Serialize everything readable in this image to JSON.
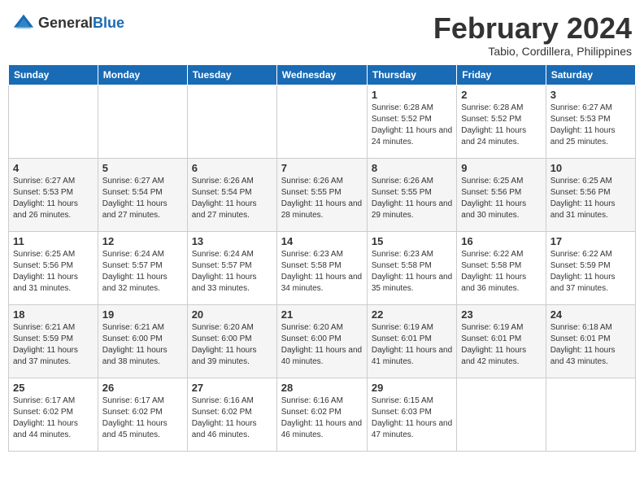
{
  "header": {
    "logo_general": "General",
    "logo_blue": "Blue",
    "month": "February 2024",
    "location": "Tabio, Cordillera, Philippines"
  },
  "days_of_week": [
    "Sunday",
    "Monday",
    "Tuesday",
    "Wednesday",
    "Thursday",
    "Friday",
    "Saturday"
  ],
  "weeks": [
    [
      {
        "day": "",
        "sunrise": "",
        "sunset": "",
        "daylight": ""
      },
      {
        "day": "",
        "sunrise": "",
        "sunset": "",
        "daylight": ""
      },
      {
        "day": "",
        "sunrise": "",
        "sunset": "",
        "daylight": ""
      },
      {
        "day": "",
        "sunrise": "",
        "sunset": "",
        "daylight": ""
      },
      {
        "day": "1",
        "sunrise": "6:28 AM",
        "sunset": "5:52 PM",
        "daylight": "11 hours and 24 minutes."
      },
      {
        "day": "2",
        "sunrise": "6:28 AM",
        "sunset": "5:52 PM",
        "daylight": "11 hours and 24 minutes."
      },
      {
        "day": "3",
        "sunrise": "6:27 AM",
        "sunset": "5:53 PM",
        "daylight": "11 hours and 25 minutes."
      }
    ],
    [
      {
        "day": "4",
        "sunrise": "6:27 AM",
        "sunset": "5:53 PM",
        "daylight": "11 hours and 26 minutes."
      },
      {
        "day": "5",
        "sunrise": "6:27 AM",
        "sunset": "5:54 PM",
        "daylight": "11 hours and 27 minutes."
      },
      {
        "day": "6",
        "sunrise": "6:26 AM",
        "sunset": "5:54 PM",
        "daylight": "11 hours and 27 minutes."
      },
      {
        "day": "7",
        "sunrise": "6:26 AM",
        "sunset": "5:55 PM",
        "daylight": "11 hours and 28 minutes."
      },
      {
        "day": "8",
        "sunrise": "6:26 AM",
        "sunset": "5:55 PM",
        "daylight": "11 hours and 29 minutes."
      },
      {
        "day": "9",
        "sunrise": "6:25 AM",
        "sunset": "5:56 PM",
        "daylight": "11 hours and 30 minutes."
      },
      {
        "day": "10",
        "sunrise": "6:25 AM",
        "sunset": "5:56 PM",
        "daylight": "11 hours and 31 minutes."
      }
    ],
    [
      {
        "day": "11",
        "sunrise": "6:25 AM",
        "sunset": "5:56 PM",
        "daylight": "11 hours and 31 minutes."
      },
      {
        "day": "12",
        "sunrise": "6:24 AM",
        "sunset": "5:57 PM",
        "daylight": "11 hours and 32 minutes."
      },
      {
        "day": "13",
        "sunrise": "6:24 AM",
        "sunset": "5:57 PM",
        "daylight": "11 hours and 33 minutes."
      },
      {
        "day": "14",
        "sunrise": "6:23 AM",
        "sunset": "5:58 PM",
        "daylight": "11 hours and 34 minutes."
      },
      {
        "day": "15",
        "sunrise": "6:23 AM",
        "sunset": "5:58 PM",
        "daylight": "11 hours and 35 minutes."
      },
      {
        "day": "16",
        "sunrise": "6:22 AM",
        "sunset": "5:58 PM",
        "daylight": "11 hours and 36 minutes."
      },
      {
        "day": "17",
        "sunrise": "6:22 AM",
        "sunset": "5:59 PM",
        "daylight": "11 hours and 37 minutes."
      }
    ],
    [
      {
        "day": "18",
        "sunrise": "6:21 AM",
        "sunset": "5:59 PM",
        "daylight": "11 hours and 37 minutes."
      },
      {
        "day": "19",
        "sunrise": "6:21 AM",
        "sunset": "6:00 PM",
        "daylight": "11 hours and 38 minutes."
      },
      {
        "day": "20",
        "sunrise": "6:20 AM",
        "sunset": "6:00 PM",
        "daylight": "11 hours and 39 minutes."
      },
      {
        "day": "21",
        "sunrise": "6:20 AM",
        "sunset": "6:00 PM",
        "daylight": "11 hours and 40 minutes."
      },
      {
        "day": "22",
        "sunrise": "6:19 AM",
        "sunset": "6:01 PM",
        "daylight": "11 hours and 41 minutes."
      },
      {
        "day": "23",
        "sunrise": "6:19 AM",
        "sunset": "6:01 PM",
        "daylight": "11 hours and 42 minutes."
      },
      {
        "day": "24",
        "sunrise": "6:18 AM",
        "sunset": "6:01 PM",
        "daylight": "11 hours and 43 minutes."
      }
    ],
    [
      {
        "day": "25",
        "sunrise": "6:17 AM",
        "sunset": "6:02 PM",
        "daylight": "11 hours and 44 minutes."
      },
      {
        "day": "26",
        "sunrise": "6:17 AM",
        "sunset": "6:02 PM",
        "daylight": "11 hours and 45 minutes."
      },
      {
        "day": "27",
        "sunrise": "6:16 AM",
        "sunset": "6:02 PM",
        "daylight": "11 hours and 46 minutes."
      },
      {
        "day": "28",
        "sunrise": "6:16 AM",
        "sunset": "6:02 PM",
        "daylight": "11 hours and 46 minutes."
      },
      {
        "day": "29",
        "sunrise": "6:15 AM",
        "sunset": "6:03 PM",
        "daylight": "11 hours and 47 minutes."
      },
      {
        "day": "",
        "sunrise": "",
        "sunset": "",
        "daylight": ""
      },
      {
        "day": "",
        "sunrise": "",
        "sunset": "",
        "daylight": ""
      }
    ]
  ]
}
